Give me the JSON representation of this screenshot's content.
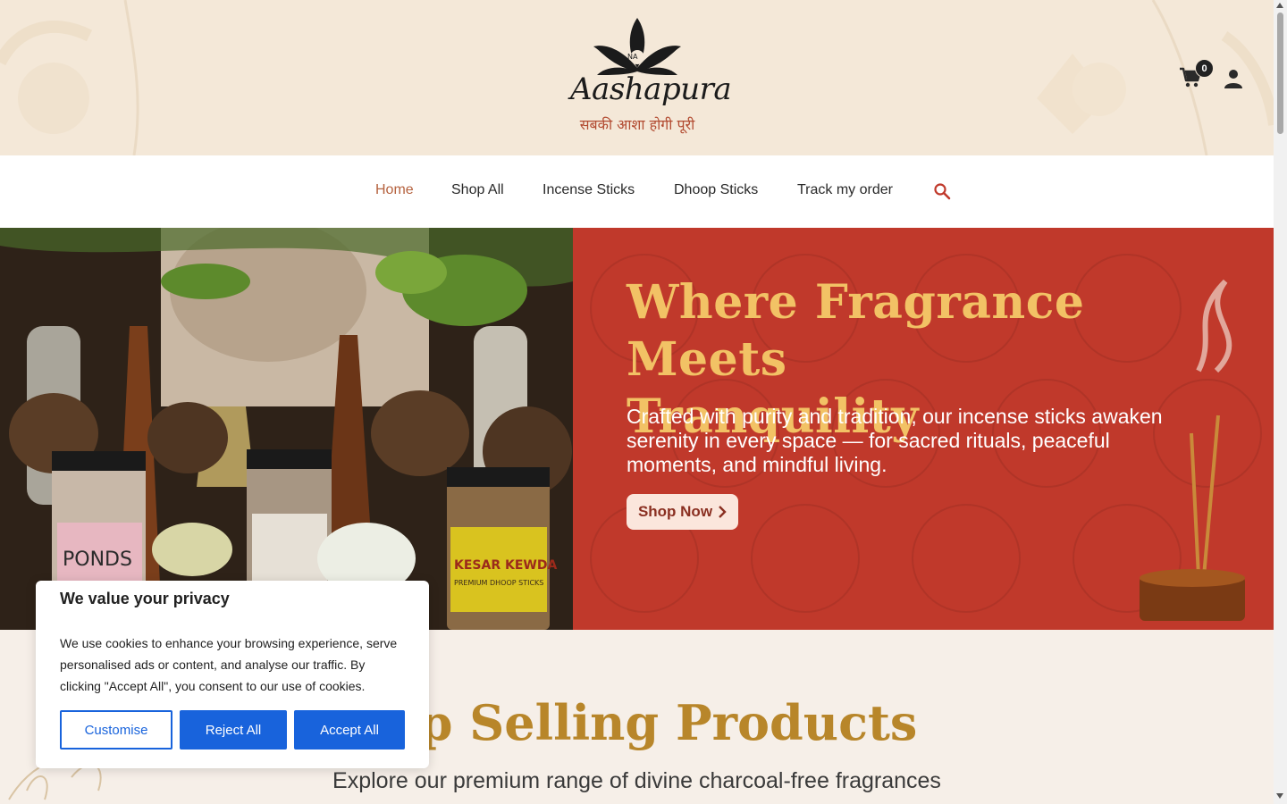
{
  "brand": {
    "name": "Aashapura",
    "monogram": "NA",
    "tagline": "सबकी आशा होगी पूरी"
  },
  "header": {
    "cart_count": "0",
    "cart_icon": "cart-icon",
    "account_icon": "user-icon"
  },
  "nav": {
    "items": [
      {
        "label": "Home",
        "active": true
      },
      {
        "label": "Shop All"
      },
      {
        "label": "Incense Sticks"
      },
      {
        "label": "Dhoop Sticks"
      },
      {
        "label": "Track my order"
      }
    ],
    "search_icon": "search-icon"
  },
  "hero": {
    "title_line1": "Where Fragrance",
    "title_line2": "Meets Tranquility",
    "subtitle": "Crafted with purity and tradition, our incense sticks awaken serenity in every space — for sacred rituals, peaceful moments, and mindful living.",
    "button_label": "Shop Now",
    "jar_labels": [
      "PONDS",
      "KESAR KEWDA",
      "PREMIUM DHOOP STICKS"
    ]
  },
  "section": {
    "title": "Top Selling Products",
    "subtitle": "Explore our premium range of divine charcoal-free fragrances"
  },
  "cookie": {
    "title": "We value your privacy",
    "text": "We use cookies to enhance your browsing experience, serve personalised ads or content, and analyse our traffic. By clicking \"Accept All\", you consent to our use of cookies.",
    "customise": "Customise",
    "reject": "Reject All",
    "accept": "Accept All"
  },
  "colors": {
    "hero_bg": "#c0392b",
    "hero_title": "#f2c265",
    "nav_active": "#b5623f",
    "section_title": "#b8862a",
    "cookie_button": "#1863dc"
  }
}
